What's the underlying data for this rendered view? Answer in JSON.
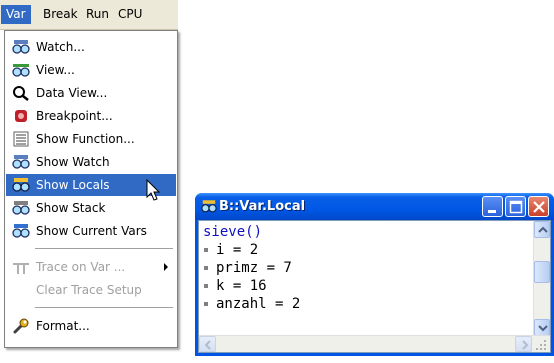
{
  "menubar": {
    "items": [
      {
        "label": "Var",
        "active": true
      },
      {
        "label": "Break",
        "active": false
      },
      {
        "label": "Run",
        "active": false
      },
      {
        "label": "CPU",
        "active": false
      }
    ]
  },
  "dropdown": {
    "items": [
      {
        "label": "Watch...",
        "icon": "glasses-icon"
      },
      {
        "label": "View...",
        "icon": "glasses-icon"
      },
      {
        "label": "Data View...",
        "icon": "magnifier-icon"
      },
      {
        "label": "Breakpoint...",
        "icon": "breakpoint-icon"
      },
      {
        "label": "Show Function...",
        "icon": "function-list-icon"
      },
      {
        "label": "Show Watch",
        "icon": "glasses-icon"
      },
      {
        "label": "Show Locals",
        "icon": "glasses-icon",
        "highlighted": true
      },
      {
        "label": "Show Stack",
        "icon": "glasses-icon"
      },
      {
        "label": "Show Current Vars",
        "icon": "glasses-icon"
      },
      {
        "label": "Trace on Var ...",
        "icon": "trace-icon",
        "disabled": true,
        "submenu": true
      },
      {
        "label": "Clear Trace Setup",
        "disabled": true
      },
      {
        "label": "Format...",
        "icon": "wrench-icon"
      }
    ]
  },
  "window": {
    "title": "B::Var.Local",
    "lines": [
      {
        "text": "sieve()",
        "head": true
      },
      {
        "text": "i = 2"
      },
      {
        "text": "primz = 7"
      },
      {
        "text": "k = 16"
      },
      {
        "text": "anzahl = 2"
      }
    ]
  },
  "colors": {
    "highlight": "#316ac5",
    "titlebar": "#0058e6",
    "menubar_bg": "#ece9d8",
    "close_button": "#c8412b"
  }
}
